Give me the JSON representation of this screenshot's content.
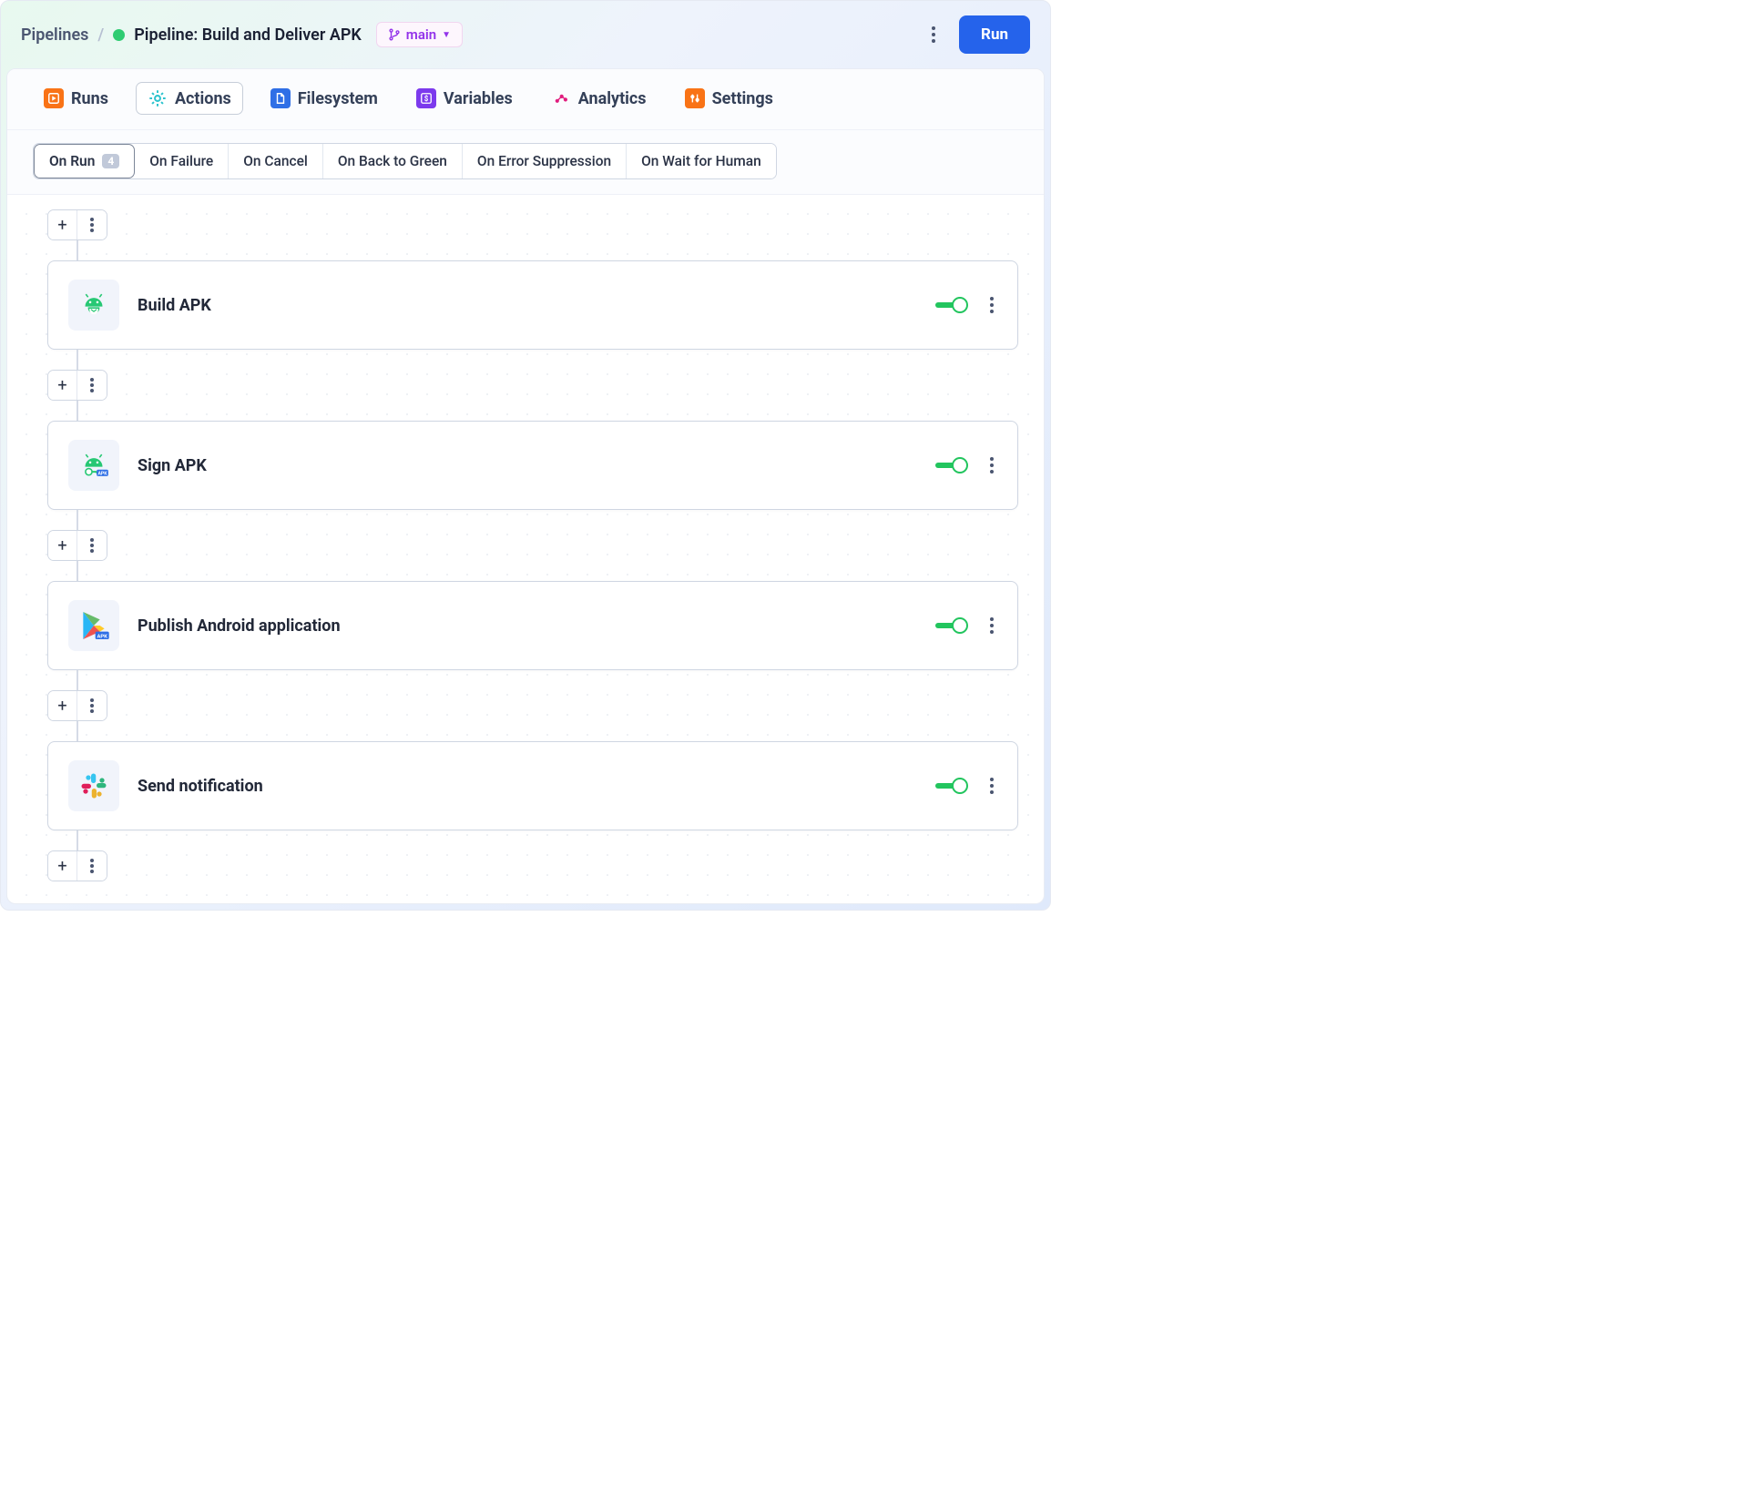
{
  "breadcrumb": {
    "root": "Pipelines",
    "title": "Pipeline: Build and Deliver APK",
    "branch": "main"
  },
  "topbar": {
    "run_label": "Run"
  },
  "tabs": [
    {
      "label": "Runs",
      "active": false
    },
    {
      "label": "Actions",
      "active": true
    },
    {
      "label": "Filesystem",
      "active": false
    },
    {
      "label": "Variables",
      "active": false
    },
    {
      "label": "Analytics",
      "active": false
    },
    {
      "label": "Settings",
      "active": false
    }
  ],
  "triggers": [
    {
      "label": "On Run",
      "badge": "4",
      "active": true
    },
    {
      "label": "On Failure",
      "active": false
    },
    {
      "label": "On Cancel",
      "active": false
    },
    {
      "label": "On Back to Green",
      "active": false
    },
    {
      "label": "On Error Suppression",
      "active": false
    },
    {
      "label": "On Wait for Human",
      "active": false
    }
  ],
  "actions": [
    {
      "title": "Build APK",
      "icon": "android-build",
      "enabled": true
    },
    {
      "title": "Sign APK",
      "icon": "android-sign",
      "enabled": true
    },
    {
      "title": "Publish Android application",
      "icon": "play-store",
      "enabled": true
    },
    {
      "title": "Send notification",
      "icon": "slack",
      "enabled": true
    }
  ]
}
